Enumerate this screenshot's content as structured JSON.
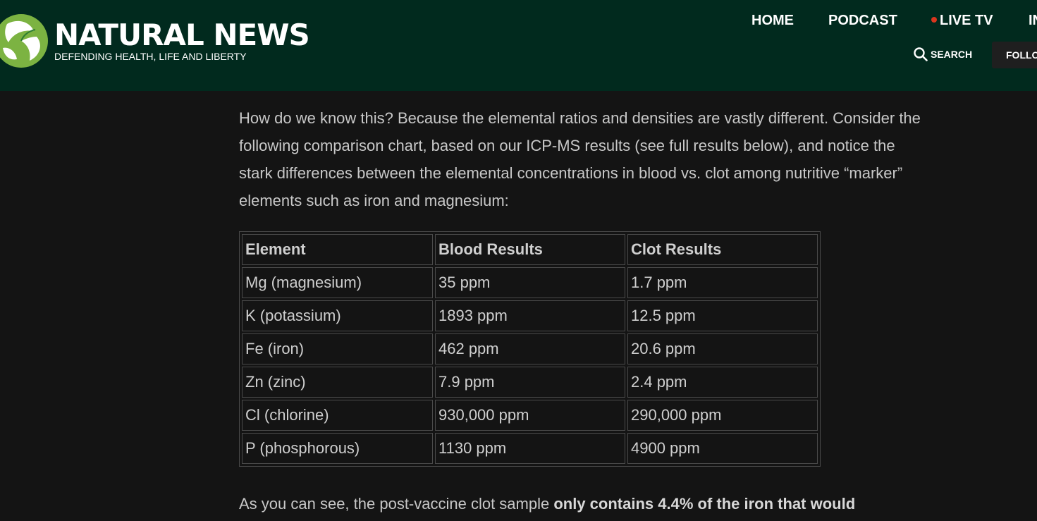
{
  "header": {
    "brand": "NATURAL NEWS",
    "tagline": "DEFENDING HEALTH, LIFE AND LIBERTY",
    "nav": {
      "home": "HOME",
      "podcast": "PODCAST",
      "live_tv": "LIVE TV",
      "partial": "IN"
    },
    "search_label": "SEARCH",
    "follow_label": "FOLLOW"
  },
  "article": {
    "intro": "How do we know this? Because the elemental ratios and densities are vastly different. Consider the following comparison chart, based on our ICP-MS results (see full results below), and notice the stark differences between the elemental concentrations in blood vs. clot among nutritive “marker” elements such as iron and magnesium:",
    "table": {
      "headers": [
        "Element",
        "Blood Results",
        "Clot Results"
      ],
      "rows": [
        [
          "Mg (magnesium)",
          "35 ppm",
          "1.7 ppm"
        ],
        [
          "K (potassium)",
          "1893 ppm",
          "12.5 ppm"
        ],
        [
          "Fe (iron)",
          "462 ppm",
          "20.6 ppm"
        ],
        [
          "Zn (zinc)",
          "7.9 ppm",
          "2.4 ppm"
        ],
        [
          "Cl (chlorine)",
          "930,000 ppm",
          "290,000 ppm"
        ],
        [
          "P (phosphorous)",
          "1130 ppm",
          "4900 ppm"
        ]
      ]
    },
    "outro_plain": "As you can see, the post-vaccine clot sample ",
    "outro_bold": "only contains 4.4% of the iron that would"
  },
  "colors": {
    "header_bg": "#012a1e",
    "page_bg": "#141414",
    "live_dot": "#d9361e"
  }
}
